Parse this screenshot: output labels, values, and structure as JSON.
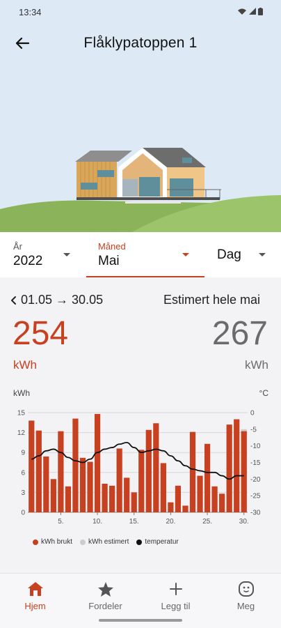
{
  "status_bar": {
    "time": "13:34"
  },
  "header": {
    "title": "Flåklypatoppen 1",
    "back_icon": "arrow-left-icon"
  },
  "period_selector": {
    "year": {
      "label": "År",
      "value": "2022"
    },
    "month": {
      "label": "Måned",
      "value": "Mai",
      "active": true
    },
    "day": {
      "label": "",
      "value": "Dag"
    }
  },
  "summary": {
    "period_range": "01.05 → 30.05",
    "estimate_label": "Estimert hele mai",
    "used_value": "254",
    "used_unit": "kWh",
    "estimated_value": "267",
    "estimated_unit": "kWh"
  },
  "chart_data": {
    "type": "bar",
    "left_axis_label": "kWh",
    "right_axis_label": "°C",
    "y_left_ticks": [
      "0",
      "3",
      "6",
      "9",
      "12",
      "15"
    ],
    "y_left_range": [
      0,
      15
    ],
    "y_right_ticks": [
      "0",
      "-5",
      "-10",
      "-15",
      "-20",
      "-25",
      "-30"
    ],
    "y_right_range": [
      -30,
      0
    ],
    "x_ticks": [
      "5.",
      "10.",
      "15.",
      "20.",
      "25.",
      "30."
    ],
    "x_days": [
      1,
      2,
      3,
      4,
      5,
      6,
      7,
      8,
      9,
      10,
      11,
      12,
      13,
      14,
      15,
      16,
      17,
      18,
      19,
      20,
      21,
      22,
      23,
      24,
      25,
      26,
      27,
      28,
      29,
      30
    ],
    "series": [
      {
        "name": "kWh brukt",
        "type": "bar",
        "color": "#c7401f",
        "values": [
          13.8,
          12.3,
          8.4,
          5.0,
          12.2,
          3.9,
          14.1,
          8.2,
          7.6,
          14.8,
          4.3,
          4.0,
          9.6,
          5.2,
          3.0,
          9.4,
          12.4,
          13.4,
          7.4,
          1.5,
          4.0,
          1.0,
          12.1,
          5.5,
          10.3,
          3.9,
          2.8,
          13.2,
          14.0,
          12.2
        ]
      },
      {
        "name": "kWh estimert",
        "type": "bar",
        "color": "#cccccc",
        "values": [
          null,
          null,
          null,
          null,
          null,
          null,
          null,
          null,
          null,
          null,
          null,
          null,
          null,
          null,
          null,
          null,
          null,
          null,
          null,
          null,
          null,
          null,
          null,
          null,
          null,
          null,
          null,
          null,
          null,
          12.5
        ]
      },
      {
        "name": "temperatur",
        "type": "line",
        "color": "#111111",
        "values": [
          -14,
          -13,
          -11.5,
          -11,
          -12,
          -13.5,
          -14.5,
          -15,
          -14,
          -12,
          -11,
          -10.5,
          -9.5,
          -9,
          -10.5,
          -12,
          -11.5,
          -11,
          -11.5,
          -13,
          -14.5,
          -16,
          -17,
          -17.5,
          -18,
          -18,
          -19,
          -20,
          -19,
          -19
        ]
      }
    ]
  },
  "legend": {
    "items": [
      {
        "label": "kWh brukt",
        "color": "#c7401f"
      },
      {
        "label": "kWh estimert",
        "color": "#cccccc"
      },
      {
        "label": "temperatur",
        "color": "#111111"
      }
    ]
  },
  "bottom_nav": {
    "items": [
      {
        "label": "Hjem",
        "icon": "home-icon",
        "active": true
      },
      {
        "label": "Fordeler",
        "icon": "star-icon",
        "active": false
      },
      {
        "label": "Legg til",
        "icon": "plus-icon",
        "active": false
      },
      {
        "label": "Meg",
        "icon": "face-icon",
        "active": false
      }
    ]
  }
}
